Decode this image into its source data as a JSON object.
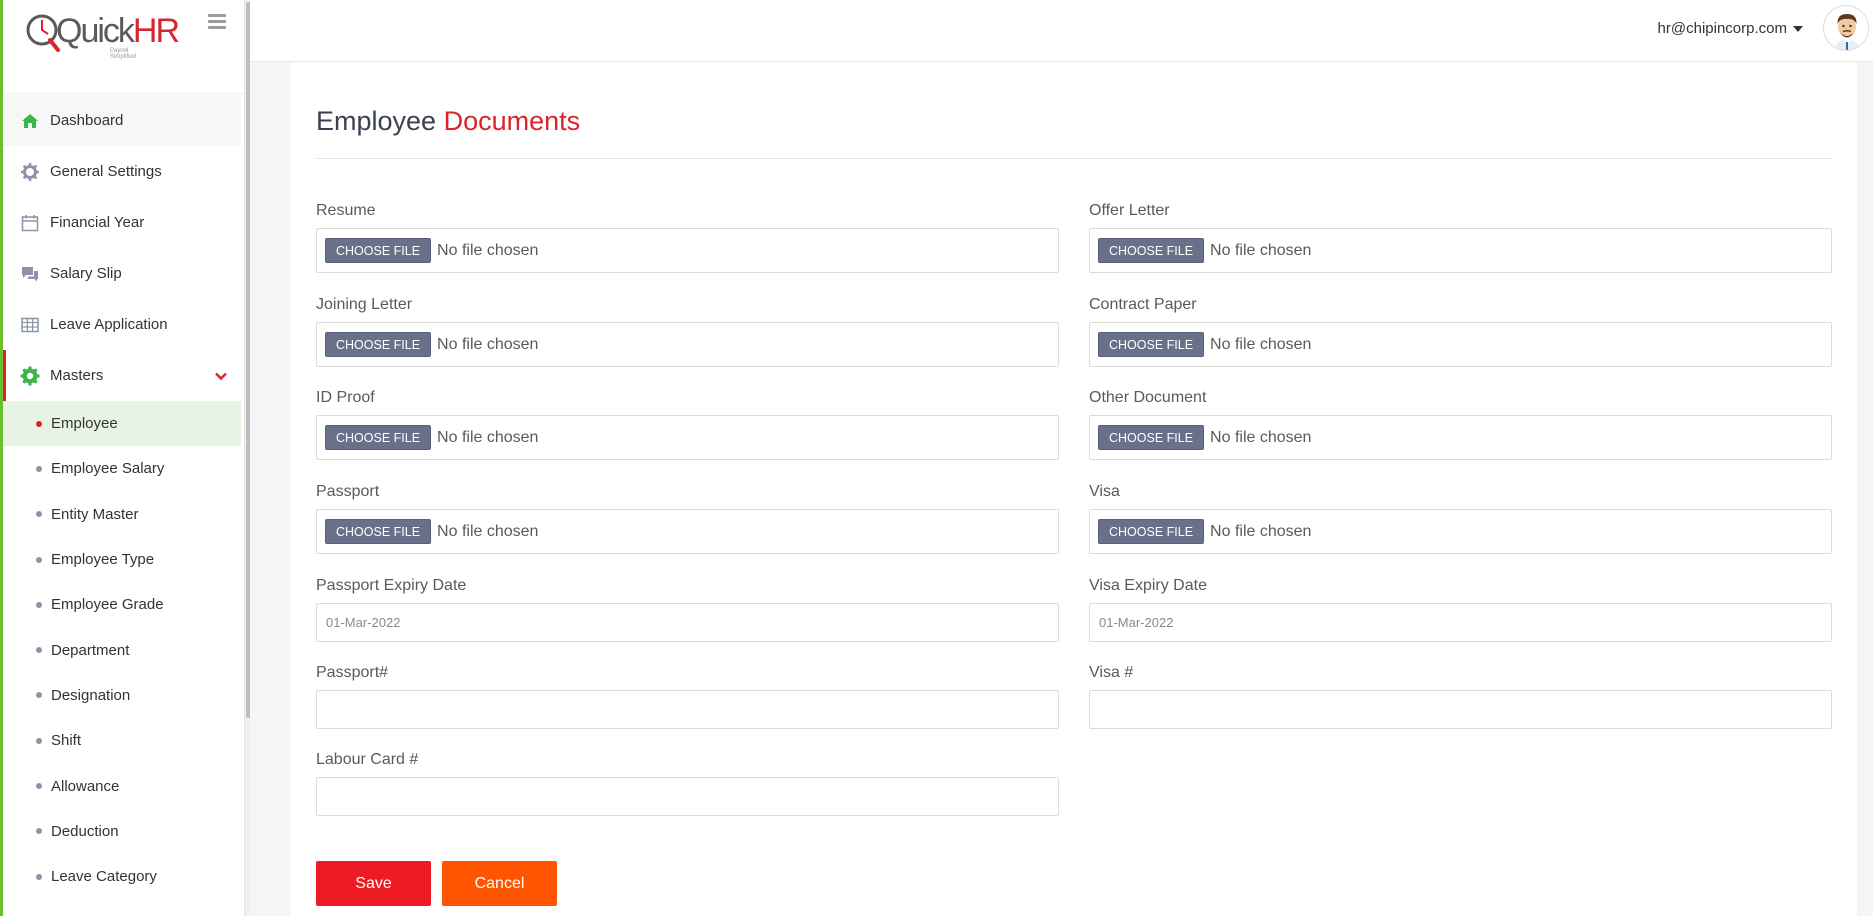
{
  "logo": {
    "brand_a": "Quick",
    "brand_b": "HR",
    "tagline": "Payroll Simplified"
  },
  "header": {
    "user_email": "hr@chipincorp.com"
  },
  "sidebar": {
    "items": [
      {
        "label": "Dashboard",
        "icon": "home-icon"
      },
      {
        "label": "General Settings",
        "icon": "gear-icon"
      },
      {
        "label": "Financial Year",
        "icon": "calendar-icon"
      },
      {
        "label": "Salary Slip",
        "icon": "chat-icon"
      },
      {
        "label": "Leave Application",
        "icon": "table-icon"
      },
      {
        "label": "Masters",
        "icon": "settings-badge-icon"
      }
    ],
    "sub_items": [
      {
        "label": "Employee"
      },
      {
        "label": "Employee Salary"
      },
      {
        "label": "Entity Master"
      },
      {
        "label": "Employee Type"
      },
      {
        "label": "Employee Grade"
      },
      {
        "label": "Department"
      },
      {
        "label": "Designation"
      },
      {
        "label": "Shift"
      },
      {
        "label": "Allowance"
      },
      {
        "label": "Deduction"
      },
      {
        "label": "Leave Category"
      }
    ]
  },
  "page": {
    "title_a": "Employee",
    "title_b": "Documents"
  },
  "form": {
    "choose_label": "CHOOSE FILE",
    "no_file": "No file chosen",
    "resume": "Resume",
    "offer_letter": "Offer Letter",
    "joining_letter": "Joining Letter",
    "contract_paper": "Contract Paper",
    "id_proof": "ID Proof",
    "other_document": "Other Document",
    "passport": "Passport",
    "visa": "Visa",
    "passport_expiry_label": "Passport Expiry Date",
    "passport_expiry_value": "01-Mar-2022",
    "visa_expiry_label": "Visa Expiry Date",
    "visa_expiry_value": "01-Mar-2022",
    "passport_no_label": "Passport#",
    "visa_no_label": "Visa #",
    "labour_card_label": "Labour Card #"
  },
  "actions": {
    "save": "Save",
    "cancel": "Cancel"
  },
  "colors": {
    "accent": "#d9232d",
    "green": "#6abf2e",
    "save": "#ed1c24",
    "cancel": "#ff5400",
    "file_button": "#69718a"
  }
}
